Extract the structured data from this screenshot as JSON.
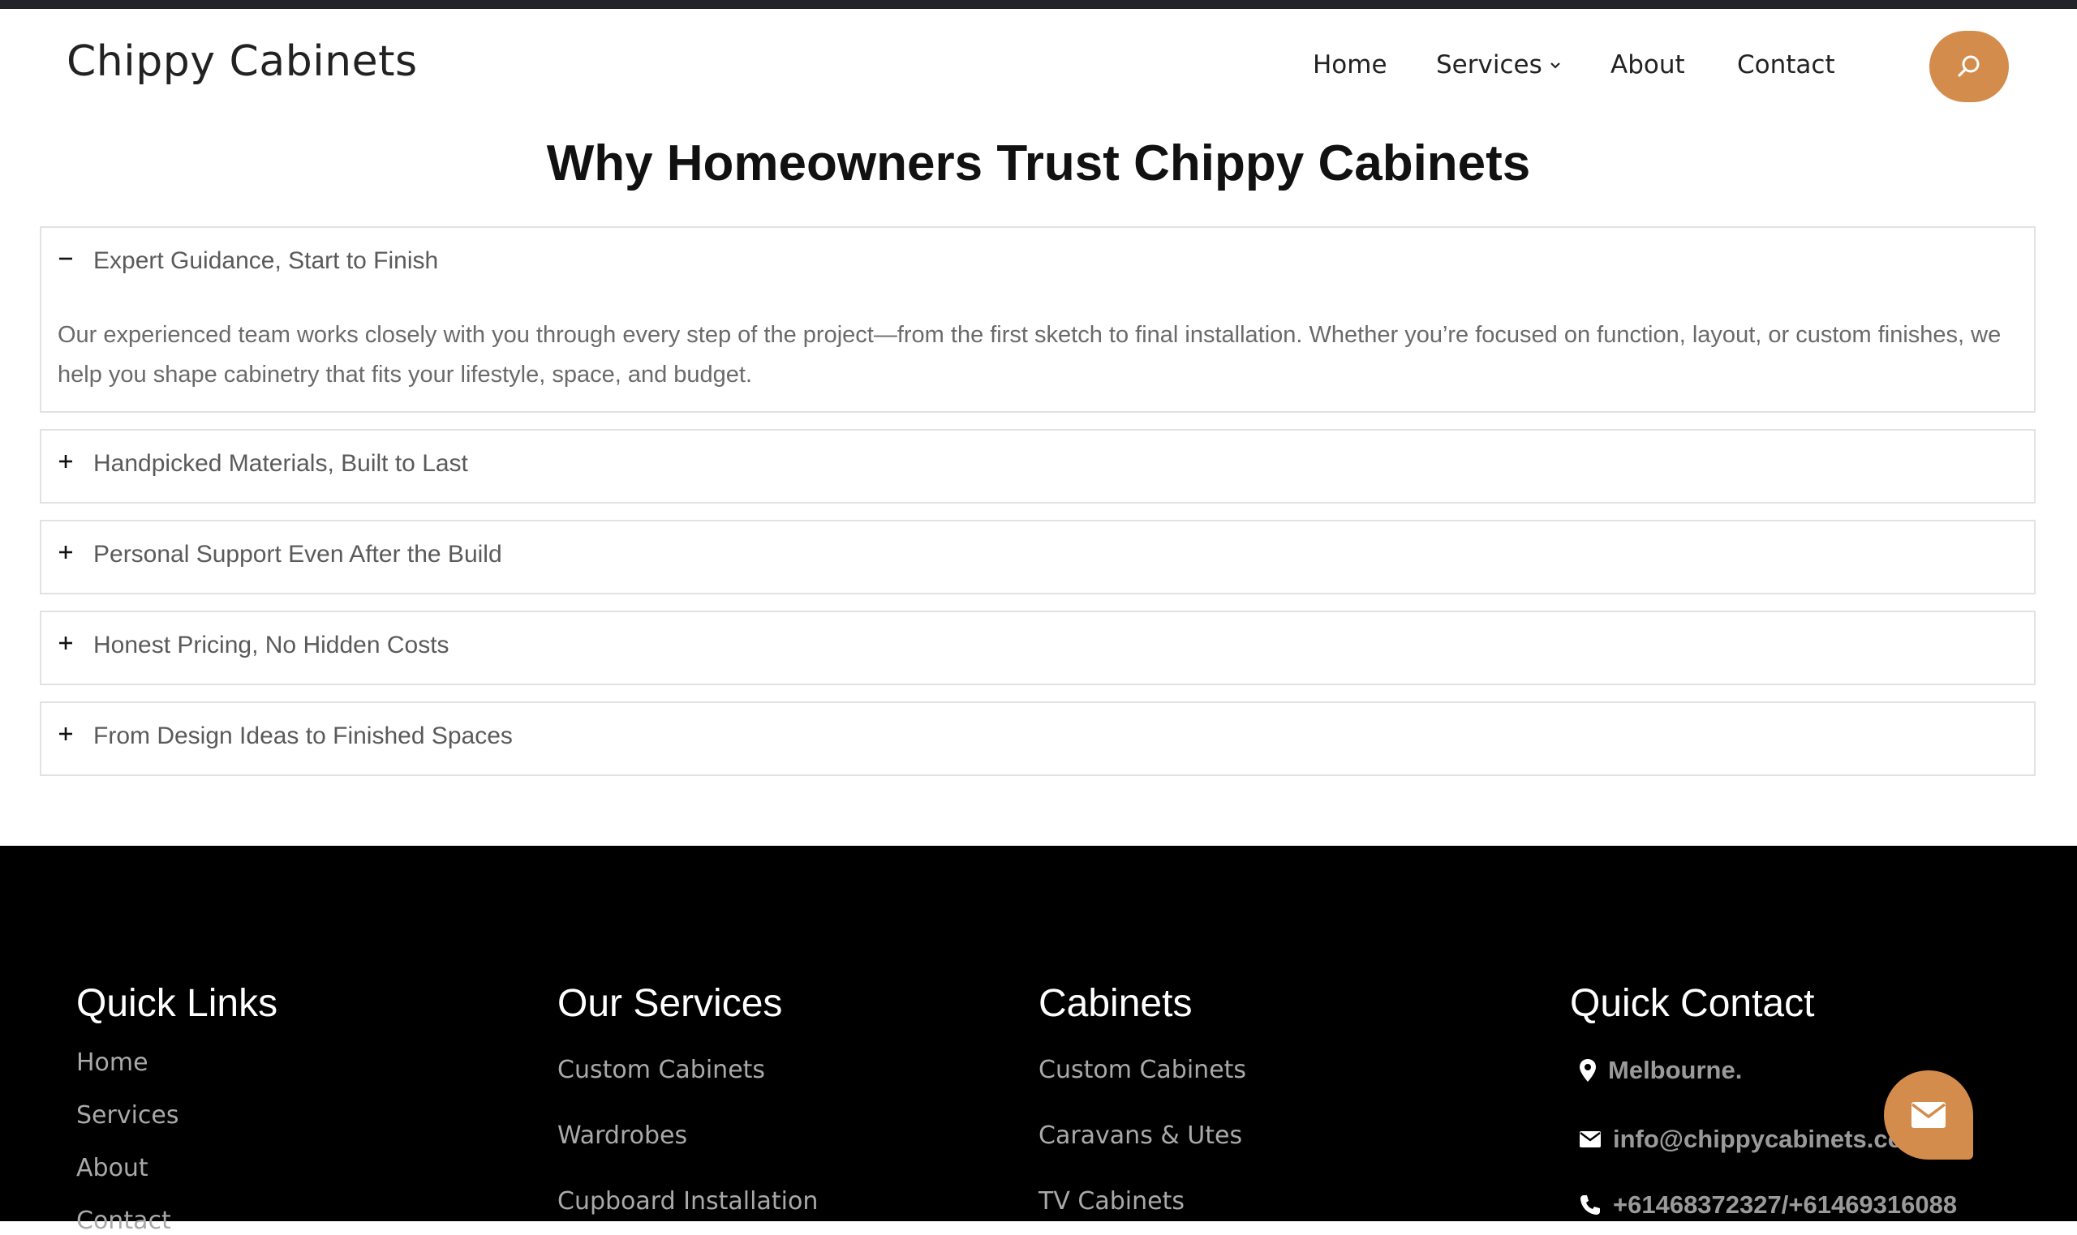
{
  "header": {
    "logo": "Chippy Cabinets",
    "nav": [
      {
        "label": "Home"
      },
      {
        "label": "Services"
      },
      {
        "label": "About"
      },
      {
        "label": "Contact"
      }
    ]
  },
  "section": {
    "title": "Why Homeowners Trust Chippy Cabinets"
  },
  "accordion": [
    {
      "title": "Expert Guidance, Start to Finish",
      "expanded": true,
      "body": "Our experienced team works closely with you through every step of the project—from the first sketch to final installation. Whether you’re focused on function, layout, or custom finishes, we help you shape cabinetry that fits your lifestyle, space, and budget."
    },
    {
      "title": "Handpicked Materials, Built to Last",
      "expanded": false
    },
    {
      "title": "Personal Support Even After the Build",
      "expanded": false
    },
    {
      "title": "Honest Pricing, No Hidden Costs",
      "expanded": false
    },
    {
      "title": "From Design Ideas to Finished Spaces",
      "expanded": false
    }
  ],
  "footer": {
    "quick_links": {
      "heading": "Quick Links",
      "items": [
        "Home",
        "Services",
        "About",
        "Contact"
      ]
    },
    "services": {
      "heading": "Our Services",
      "items": [
        "Custom Cabinets",
        "Wardrobes",
        "Cupboard Installation"
      ]
    },
    "cabinets": {
      "heading": "Cabinets",
      "items": [
        "Custom Cabinets",
        "Caravans & Utes",
        "TV Cabinets"
      ]
    },
    "contact": {
      "heading": "Quick Contact",
      "location": "Melbourne.",
      "email": "info@chippycabinets.com",
      "phone": "+61468372327/+61469316088"
    }
  },
  "colors": {
    "accent": "#d38c4c",
    "footer_bg": "#000000",
    "top_bar": "#23232a"
  }
}
